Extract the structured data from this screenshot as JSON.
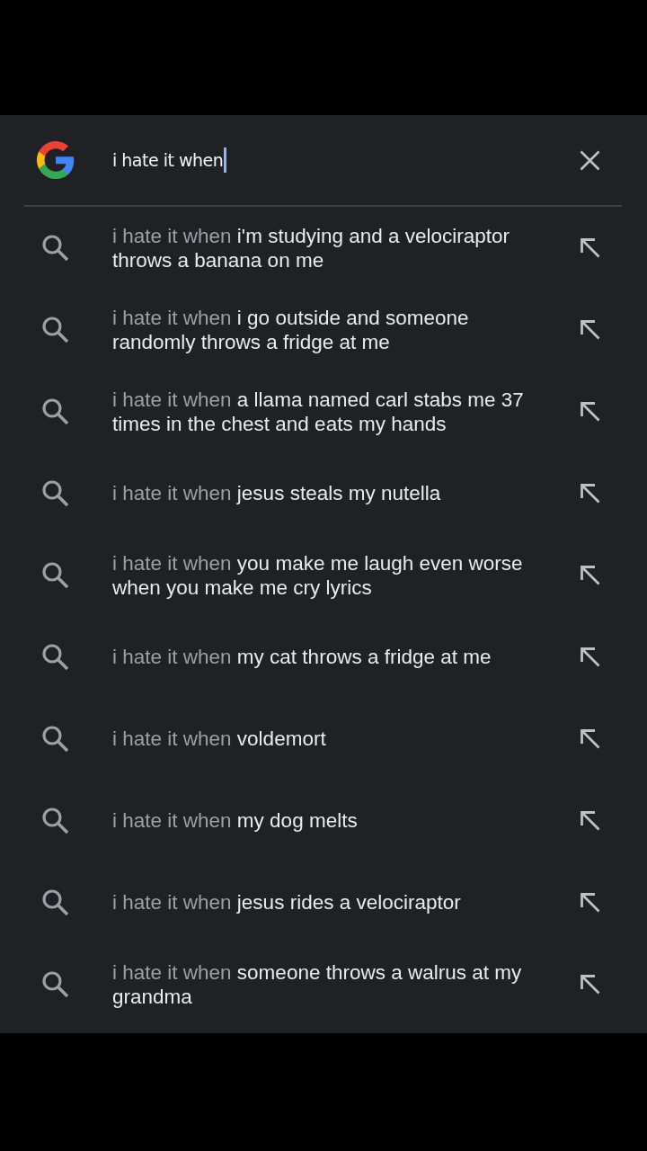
{
  "search_bar": {
    "query": "i hate it when",
    "focused": true
  },
  "suggestions": [
    {
      "prefix": "i hate it when",
      "completion": "i'm studying and a velociraptor throws a banana on me"
    },
    {
      "prefix": "i hate it when",
      "completion": "i go outside and someone randomly throws a fridge at me"
    },
    {
      "prefix": "i hate it when",
      "completion": "a llama named carl stabs me 37 times in the chest and eats my hands"
    },
    {
      "prefix": "i hate it when",
      "completion": "jesus steals my nutella"
    },
    {
      "prefix": "i hate it when",
      "completion": "you make me laugh even worse when you make me cry lyrics"
    },
    {
      "prefix": "i hate it when",
      "completion": "my cat throws a fridge at me"
    },
    {
      "prefix": "i hate it when",
      "completion": "voldemort"
    },
    {
      "prefix": "i hate it when",
      "completion": "my dog melts"
    },
    {
      "prefix": "i hate it when",
      "completion": "jesus rides a velociraptor"
    },
    {
      "prefix": "i hate it when",
      "completion": "someone throws a walrus at my grandma"
    }
  ]
}
